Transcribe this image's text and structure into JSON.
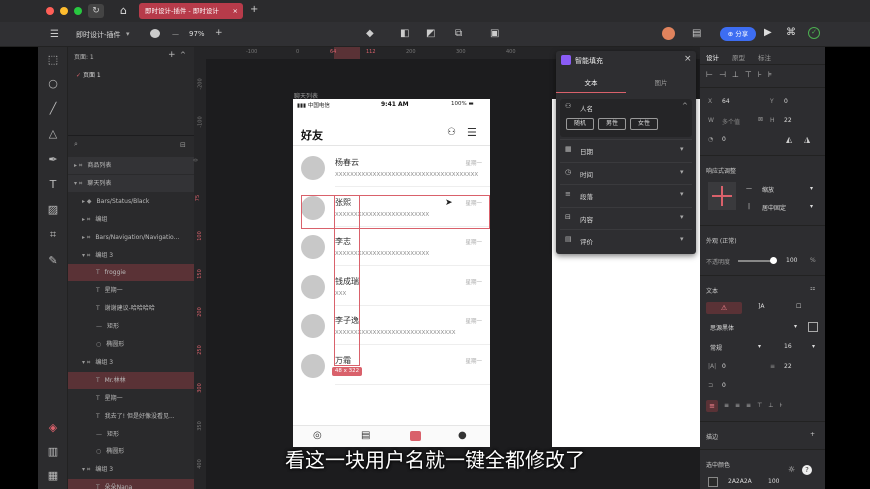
{
  "tabs": {
    "active": "即时设计-插件 - 即时设计",
    "plus": "+"
  },
  "toolbar": {
    "doc_title": "即时设计-插件",
    "zoom": "97%",
    "share": "分享"
  },
  "layers": {
    "pages_title": "页面: 1",
    "page1": "页面 1",
    "search_placeholder": "",
    "items": [
      {
        "label": "商品列表"
      },
      {
        "label": "聊天列表"
      },
      {
        "label": "Bars/Status/Black"
      },
      {
        "label": "编组"
      },
      {
        "label": "Bars/Navigation/Navigatio..."
      },
      {
        "label": "编组 3"
      },
      {
        "label": "froggie"
      },
      {
        "label": "星期一"
      },
      {
        "label": "谢谢建议-哈哈哈哈"
      },
      {
        "label": "矩形"
      },
      {
        "label": "椭圆形"
      },
      {
        "label": "编组 3"
      },
      {
        "label": "Mr.林林"
      },
      {
        "label": "星期一"
      },
      {
        "label": "我去了! 但是好像没看见..."
      },
      {
        "label": "矩形"
      },
      {
        "label": "椭圆形"
      },
      {
        "label": "编组 3"
      },
      {
        "label": "朵朵Nana"
      }
    ]
  },
  "ruler": {
    "ticks": [
      "-100",
      "0",
      "64",
      "112",
      "200",
      "300",
      "400"
    ],
    "vticks": [
      "-200",
      "-100",
      "0",
      "75",
      "100",
      "150",
      "200",
      "250",
      "300",
      "350",
      "400"
    ]
  },
  "frame_label": "聊天列表",
  "phone": {
    "carrier": "中国电信",
    "time": "9:41 AM",
    "battery": "100%",
    "title": "好友",
    "rows": [
      {
        "name": "杨春云",
        "msg": "XXXXXXXXXXXXXXXXXXXXXXXXXXXXXXXXXXXXXX",
        "day": "星期一"
      },
      {
        "name": "张熙",
        "msg": "XXXXXXXXXXXXXXXXXXXXXXXXX",
        "day": "星期一"
      },
      {
        "name": "李志",
        "msg": "XXXXXXXXXXXXXXXXXXXXXXXXX",
        "day": "星期一"
      },
      {
        "name": "钱成瑞",
        "msg": "XXX",
        "day": "星期一"
      },
      {
        "name": "李子逸",
        "msg": "XXXXXXXXXXXXXXXXXXXXXXXXXXXXXXXX",
        "day": "星期一"
      },
      {
        "name": "万霜",
        "msg": "XXXXXX",
        "day": "星期一"
      }
    ],
    "size_badge": "48 x 322"
  },
  "plugin": {
    "title": "智能填充",
    "tab_text": "文本",
    "tab_image": "图片",
    "person": "人名",
    "chips": [
      "随机",
      "男性",
      "女性"
    ],
    "items": [
      "日期",
      "时间",
      "段落",
      "内容",
      "评价"
    ]
  },
  "inspector": {
    "tabs": [
      "设计",
      "原型",
      "标注"
    ],
    "x_label": "X",
    "x": "64",
    "y_label": "Y",
    "y": "0",
    "w_label": "W",
    "w": "多个值",
    "h_label": "H",
    "h": "22",
    "rot": "0",
    "responsive_title": "响应式调整",
    "resp_h": "缩放",
    "resp_v": "居中固定",
    "appearance": "外观 (正常)",
    "opacity_label": "不透明度",
    "opacity": "100",
    "opacity_unit": "%",
    "text_title": "文本",
    "font": "思源黑体",
    "weight": "常规",
    "size": "16",
    "letter": "0",
    "line": "22",
    "para": "0",
    "stroke_title": "描边",
    "fill_title": "选中颜色",
    "fill_hex": "2A2A2A",
    "fill_opacity": "100"
  },
  "subtitle": "看这一块用户名就一键全都修改了",
  "colors": {
    "accent": "#d9616b",
    "selected_row": "#5a3236",
    "share": "#3d6df2"
  }
}
